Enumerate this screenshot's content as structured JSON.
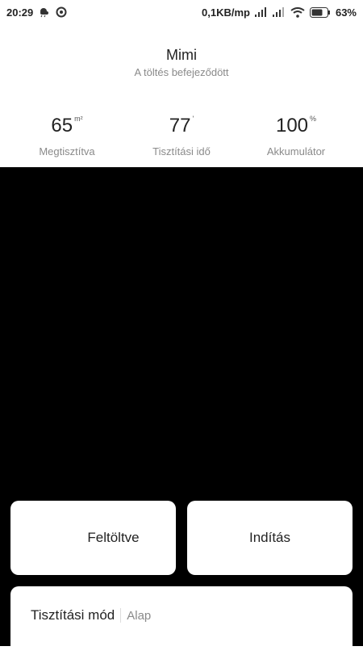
{
  "status_bar": {
    "time": "20:29",
    "network_speed": "0,1KB/mp",
    "battery": "63%"
  },
  "device": {
    "name": "Mimi",
    "status": "A töltés befejeződött"
  },
  "stats": [
    {
      "value": "65",
      "unit": "m²",
      "label": "Megtisztítva"
    },
    {
      "value": "77",
      "unit": "'",
      "label": "Tisztítási idő"
    },
    {
      "value": "100",
      "unit": "%",
      "label": "Akkumulátor"
    }
  ],
  "buttons": {
    "dock": "Feltöltve",
    "start": "Indítás"
  },
  "mode": {
    "title": "Tisztítási mód",
    "value": "Alap"
  }
}
